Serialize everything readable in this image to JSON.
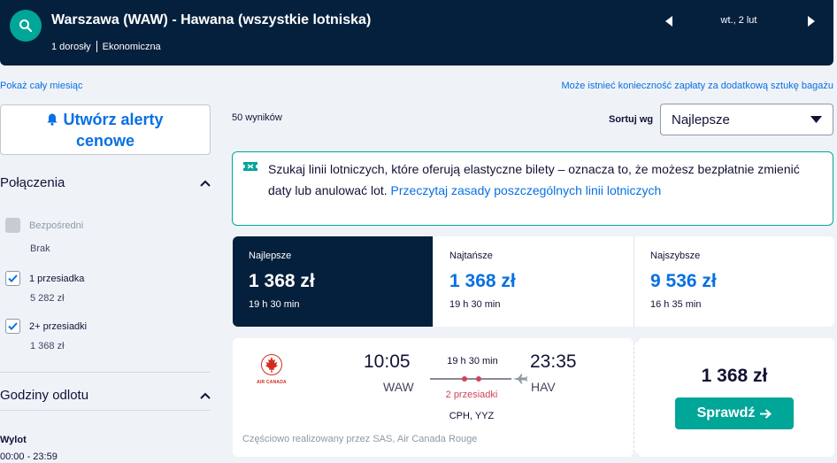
{
  "header": {
    "route": "Warszawa (WAW) - Hawana (wszystkie lotniska)",
    "passengers": "1 dorosły",
    "cabin": "Ekonomiczna",
    "date": "wt., 2 lut"
  },
  "links": {
    "month": "Pokaż cały miesiąc",
    "baggage": "Może istnieć konieczność zapłaty za dodatkową sztukę bagażu"
  },
  "alerts": {
    "line1": "Utwórz alerty",
    "line2": "cenowe"
  },
  "filters": {
    "connections_title": "Połączenia",
    "direct_label": "Bezpośredni",
    "direct_sub": "Brak",
    "one_stop_label": "1 przesiadka",
    "one_stop_sub": "5 282 zł",
    "two_stop_label": "2+ przesiadki",
    "two_stop_sub": "1 368 zł",
    "departure_title": "Godziny odlotu",
    "outbound_label": "Wylot",
    "outbound_range": "00:00 - 23:59"
  },
  "results": {
    "count": "50 wyników",
    "sort_label": "Sortuj wg",
    "sort_value": "Najlepsze"
  },
  "info": {
    "text": "Szukaj linii lotniczych, które oferują elastyczne bilety – oznacza to, że możesz bezpłatnie zmienić daty lub anulować lot.",
    "link": "Przeczytaj zasady poszczególnych linii lotniczych"
  },
  "tabs": [
    {
      "name": "Najlepsze",
      "price": "1 368 zł",
      "duration": "19 h 30 min"
    },
    {
      "name": "Najtańsze",
      "price": "1 368 zł",
      "duration": "19 h 30 min"
    },
    {
      "name": "Najszybsze",
      "price": "9 536 zł",
      "duration": "16 h 35 min"
    }
  ],
  "flight": {
    "airline": "AIR CANADA",
    "dep_time": "10:05",
    "dep_code": "WAW",
    "arr_time": "23:35",
    "arr_code": "HAV",
    "duration": "19 h 30 min",
    "stops": "2 przesiadki",
    "via": "CPH, YYZ",
    "operated": "Częściowo realizowany przez SAS, Air Canada Rouge",
    "price": "1 368 zł",
    "button": "Sprawdź"
  },
  "colors": {
    "navy": "#05203c",
    "teal": "#00a698",
    "blue": "#0770e3",
    "stop_red": "#d1435b"
  }
}
